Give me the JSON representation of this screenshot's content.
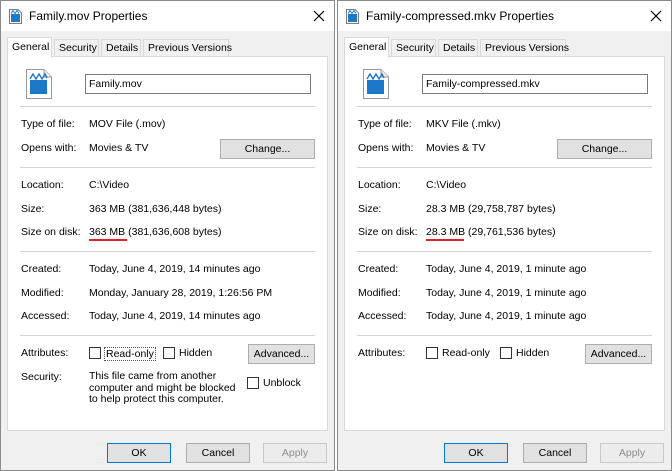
{
  "dialogs": [
    {
      "title": "Family.mov Properties",
      "tabs": [
        "General",
        "Security",
        "Details",
        "Previous Versions"
      ],
      "file_name": "Family.mov",
      "type_label": "Type of file:",
      "type_value": "MOV File (.mov)",
      "opens_label": "Opens with:",
      "opens_value": "Movies & TV",
      "change_button": "Change...",
      "location_label": "Location:",
      "location_value": "C:\\Video",
      "size_label": "Size:",
      "size_value": "363 MB (381,636,448 bytes)",
      "size_on_disk_label": "Size on disk:",
      "size_on_disk_value": "363 MB (381,636,608 bytes)",
      "created_label": "Created:",
      "created_value": "Today, June 4, 2019, 14 minutes ago",
      "modified_label": "Modified:",
      "modified_value": "Monday, January 28, 2019, 1:26:56 PM",
      "accessed_label": "Accessed:",
      "accessed_value": "Today, June 4, 2019, 14 minutes ago",
      "attributes_label": "Attributes:",
      "readonly_label": "Read-only",
      "hidden_label": "Hidden",
      "advanced_button": "Advanced...",
      "security_label": "Security:",
      "security_text": "This file came from another computer and might be blocked to help protect this computer.",
      "unblock_label": "Unblock",
      "ok_button": "OK",
      "cancel_button": "Cancel",
      "apply_button": "Apply"
    },
    {
      "title": "Family-compressed.mkv Properties",
      "tabs": [
        "General",
        "Security",
        "Details",
        "Previous Versions"
      ],
      "file_name": "Family-compressed.mkv",
      "type_label": "Type of file:",
      "type_value": "MKV File (.mkv)",
      "opens_label": "Opens with:",
      "opens_value": "Movies & TV",
      "change_button": "Change...",
      "location_label": "Location:",
      "location_value": "C:\\Video",
      "size_label": "Size:",
      "size_value": "28.3 MB (29,758,787 bytes)",
      "size_on_disk_label": "Size on disk:",
      "size_on_disk_value": "28.3 MB (29,761,536 bytes)",
      "created_label": "Created:",
      "created_value": "Today, June 4, 2019, 1 minute ago",
      "modified_label": "Modified:",
      "modified_value": "Today, June 4, 2019, 1 minute ago",
      "accessed_label": "Accessed:",
      "accessed_value": "Today, June 4, 2019, 1 minute ago",
      "attributes_label": "Attributes:",
      "readonly_label": "Read-only",
      "hidden_label": "Hidden",
      "advanced_button": "Advanced...",
      "ok_button": "OK",
      "cancel_button": "Cancel",
      "apply_button": "Apply"
    }
  ],
  "colors": {
    "dialog_bg": "#f0f0f0",
    "panel_bg": "#ffffff",
    "highlight_underline": "#e0202a",
    "default_button_border": "#0078d7",
    "file_icon": "#1e78c8"
  }
}
